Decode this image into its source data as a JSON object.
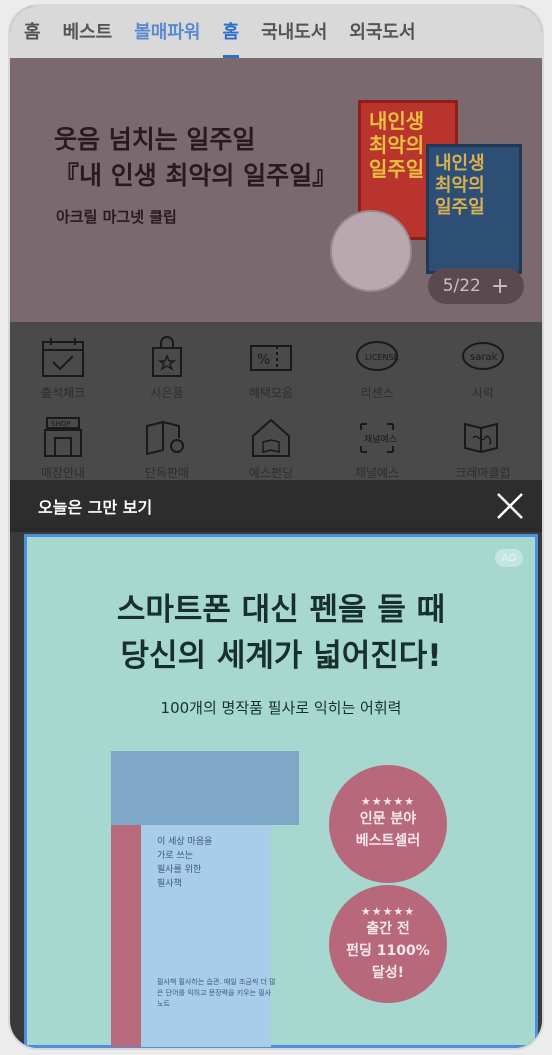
{
  "tabs": {
    "items": [
      {
        "label": "홈"
      },
      {
        "label": "베스트"
      },
      {
        "label": "볼매파워"
      },
      {
        "label": "홈"
      },
      {
        "label": "국내도서"
      },
      {
        "label": "외국도서"
      }
    ]
  },
  "banner": {
    "title_line1": "웃음 넘치는 일주일",
    "title_line2": "『내 인생 최악의 일주일』",
    "subtitle": "아크릴 마그넷 클립",
    "book1_title": "내인생\n최악의\n일주일",
    "book2_title": "내인생\n최악의\n일주일",
    "counter": "5/22",
    "counter_plus": "+"
  },
  "quick_menu": {
    "items": [
      {
        "label": "출석체크",
        "icon": "calendar-check-icon"
      },
      {
        "label": "사은품",
        "icon": "gift-bag-icon"
      },
      {
        "label": "혜택모음",
        "icon": "coupon-icon"
      },
      {
        "label": "리센스",
        "icon": "license-icon"
      },
      {
        "label": "사락",
        "icon": "sarak-icon"
      },
      {
        "label": "매장안내",
        "icon": "shop-icon"
      },
      {
        "label": "단독판매",
        "icon": "book-search-icon"
      },
      {
        "label": "예스펀딩",
        "icon": "house-book-icon"
      },
      {
        "label": "채널예스",
        "icon": "channel-yes-icon"
      },
      {
        "label": "크레마클럽",
        "icon": "crema-club-icon"
      }
    ]
  },
  "overlay": {
    "today_label": "오늘은 그만 보기",
    "close_icon": "close-icon"
  },
  "ad": {
    "badge": "AD",
    "headline_line1": "스마트폰 대신 펜을 들 때",
    "headline_line2": "당신의 세계가 넓어진다!",
    "subline": "100개의 명작품 필사로 익히는 어휘력",
    "book_text": "이 세상 마음을\n가로 쓰는\n필사를 위한\n필사책",
    "book_text2": "필사책 필사하는 습관. 매일 조금씩 더 많은 단어를 익히고 문장력을 키우는 필사 노트",
    "circle1_stars": "★★★★★",
    "circle1_line1": "인문 분야",
    "circle1_line2": "베스트셀러",
    "circle2_stars": "★★★★★",
    "circle2_line1": "출간 전",
    "circle2_line2": "펀딩 1100%",
    "circle2_line3": "달성!"
  },
  "colors": {
    "accent": "#2a6fc9",
    "ad_background": "#a7d8d0",
    "ad_border": "#4b8fe0",
    "circle": "#b7687a"
  }
}
